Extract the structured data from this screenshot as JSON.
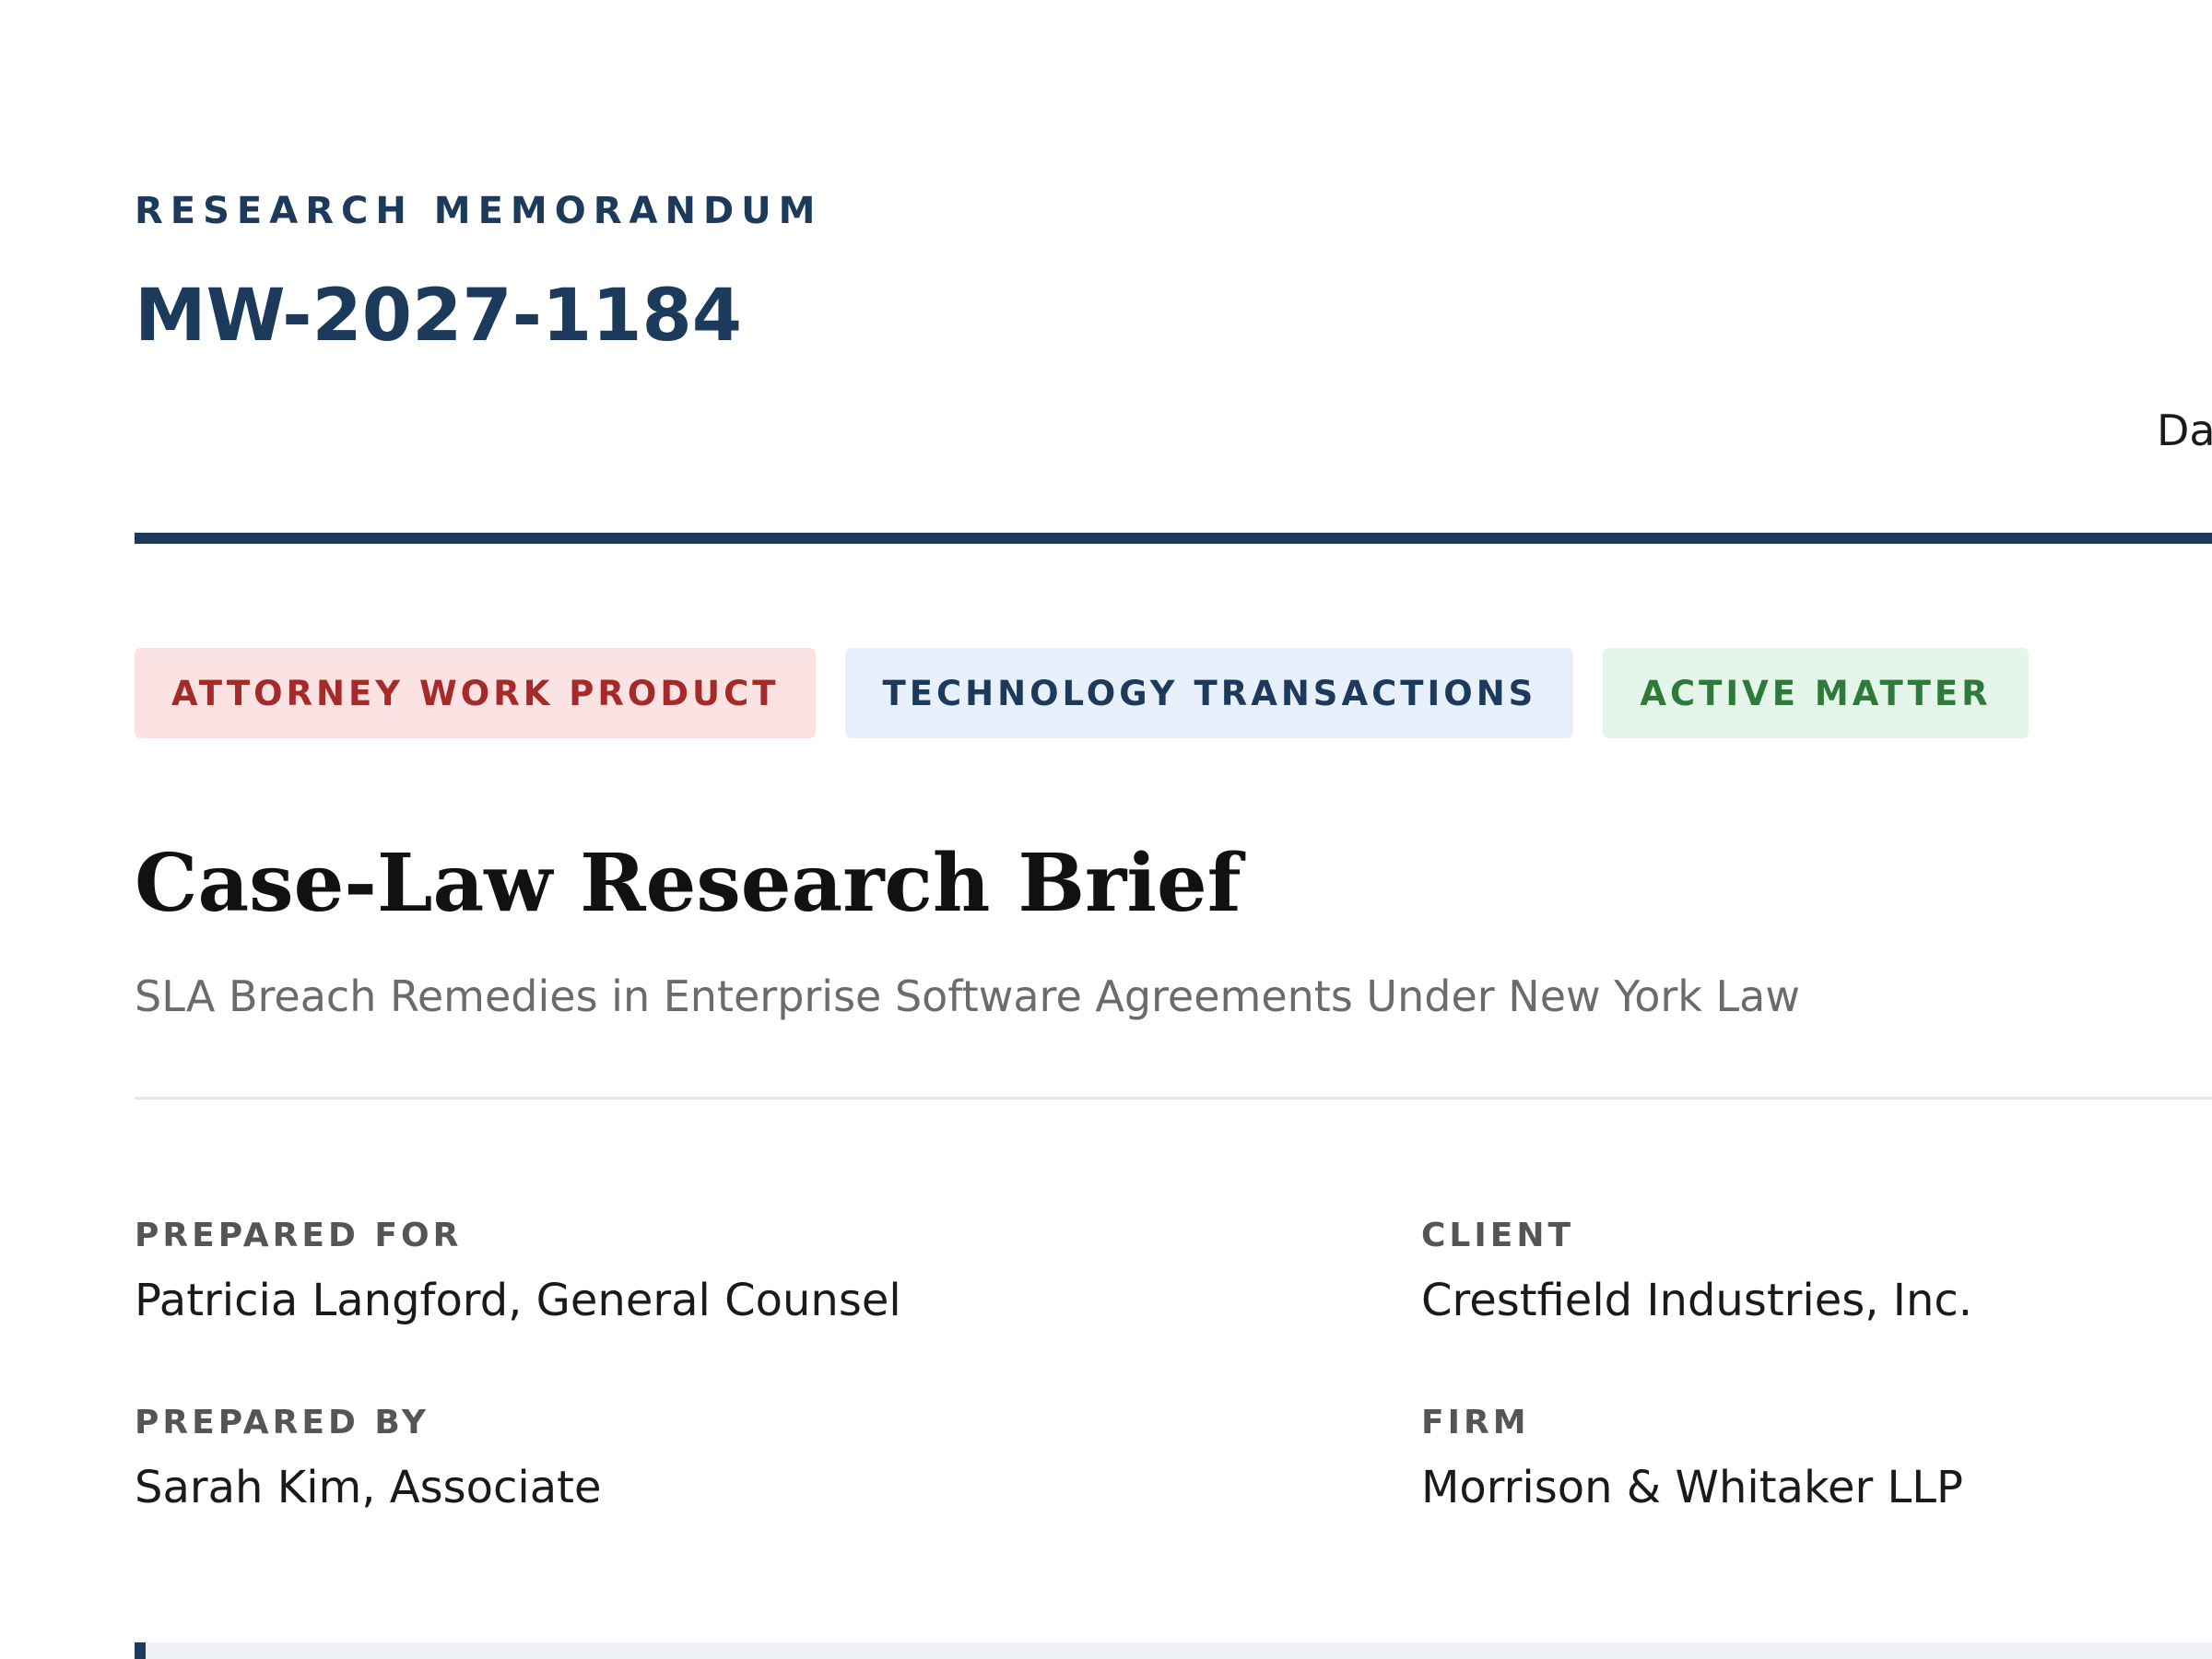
{
  "header": {
    "eyebrow": "RESEARCH MEMORANDUM",
    "memo_id": "MW-2027-1184",
    "date_label": "Da"
  },
  "tags": [
    {
      "label": "ATTORNEY WORK PRODUCT",
      "color": "#a52a2a",
      "background": "#fbe3e4"
    },
    {
      "label": "TECHNOLOGY TRANSACTIONS",
      "color": "#1b3a5c",
      "background": "#e8f0fc"
    },
    {
      "label": "ACTIVE MATTER",
      "color": "#2d7a3a",
      "background": "#e6f5e9"
    }
  ],
  "document": {
    "title": "Case-Law Research Brief",
    "subtitle": "SLA Breach Remedies in Enterprise Software Agreements Under New York Law"
  },
  "fields": {
    "prepared_for": {
      "label": "PREPARED FOR",
      "value": "Patricia Langford, General Counsel"
    },
    "client": {
      "label": "CLIENT",
      "value": "Crestfield Industries, Inc."
    },
    "prepared_by": {
      "label": "PREPARED BY",
      "value": "Sarah Kim, Associate"
    },
    "firm": {
      "label": "FIRM",
      "value": "Morrison & Whitaker LLP"
    }
  },
  "colors": {
    "accent": "#1b3a5c"
  }
}
